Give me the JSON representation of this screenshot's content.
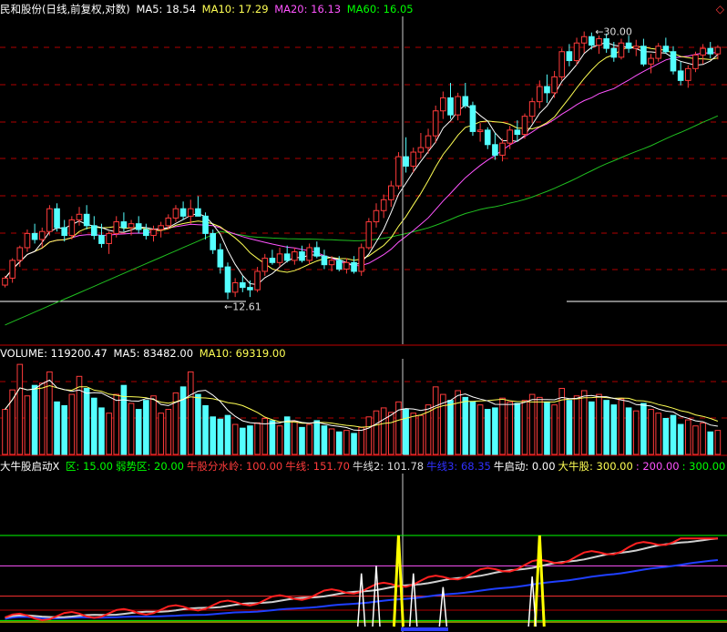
{
  "colors": {
    "up": "#ff3b3b",
    "down": "#54ffff",
    "ma5": "#ffffff",
    "ma10": "#ffff54",
    "ma20": "#ff54ff",
    "ma60": "#00c000",
    "grid": "#b00000",
    "bg": "#000000"
  },
  "panel_price": {
    "stock": "民和股份(日线,前复权,对数)",
    "ma5_label": "MA5: 18.54",
    "ma10_label": "MA10: 17.29",
    "ma20_label": "MA20: 16.13",
    "ma60_label": "MA60: 16.05",
    "high_marker": "30.00",
    "low_marker": "12.61",
    "corner_icon": "diamond-icon"
  },
  "panel_volume": {
    "volume_label": "VOLUME: 119200.47",
    "ma5_label": "MA5: 83482.00",
    "ma10_label": "MA10: 69319.00"
  },
  "panel_indicator": {
    "name": "大牛股启动X",
    "items": [
      {
        "text": "区: 15.00",
        "color": "#00ff00"
      },
      {
        "text": "弱势区: 20.00",
        "color": "#00ff00"
      },
      {
        "text": "牛股分水岭: 100.00",
        "color": "#ff3b3b"
      },
      {
        "text": "牛线: 151.70",
        "color": "#ff3b3b"
      },
      {
        "text": "牛线2: 101.78",
        "color": "#dddddd"
      },
      {
        "text": "牛线3: 68.35",
        "color": "#3030ff"
      },
      {
        "text": "牛启动: 0.00",
        "color": "#ffffff"
      },
      {
        "text": "大牛股: 300.00",
        "color": "#ffff54"
      },
      {
        "text": ": 200.00",
        "color": "#ff54ff"
      },
      {
        "text": ": 300.00",
        "color": "#00ff00"
      },
      {
        "text": ":",
        "color": "#ffffff"
      }
    ]
  },
  "chart_data": {
    "type": "candlestick",
    "log_scale": true,
    "ylim": [
      10.9,
      31.5
    ],
    "candles": [
      [
        13.2,
        13.6,
        13.1,
        13.5
      ],
      [
        13.5,
        14.4,
        13.3,
        14.3
      ],
      [
        14.3,
        15.0,
        14.0,
        14.9
      ],
      [
        14.9,
        15.8,
        14.7,
        15.6
      ],
      [
        15.6,
        16.1,
        15.1,
        15.3
      ],
      [
        15.3,
        15.9,
        14.9,
        15.7
      ],
      [
        15.7,
        17.1,
        15.5,
        16.9
      ],
      [
        16.9,
        17.2,
        15.7,
        15.9
      ],
      [
        15.9,
        16.3,
        15.2,
        15.5
      ],
      [
        15.5,
        16.5,
        15.3,
        16.3
      ],
      [
        16.3,
        17.0,
        16.0,
        16.6
      ],
      [
        16.6,
        17.1,
        15.8,
        16.0
      ],
      [
        16.0,
        16.5,
        15.3,
        15.5
      ],
      [
        15.5,
        16.1,
        14.9,
        15.1
      ],
      [
        15.1,
        15.7,
        14.6,
        15.6
      ],
      [
        15.6,
        16.5,
        15.4,
        16.2
      ],
      [
        16.2,
        16.7,
        15.7,
        15.9
      ],
      [
        15.9,
        16.3,
        15.5,
        16.1
      ],
      [
        16.1,
        16.5,
        15.6,
        15.8
      ],
      [
        15.8,
        16.1,
        15.3,
        15.5
      ],
      [
        15.5,
        16.0,
        15.2,
        15.8
      ],
      [
        15.8,
        16.2,
        15.4,
        16.0
      ],
      [
        16.0,
        16.6,
        15.8,
        16.4
      ],
      [
        16.4,
        17.1,
        16.2,
        16.9
      ],
      [
        16.9,
        17.3,
        16.3,
        16.5
      ],
      [
        16.5,
        17.4,
        16.1,
        16.9
      ],
      [
        16.9,
        17.6,
        16.6,
        16.5
      ],
      [
        16.5,
        16.7,
        15.3,
        15.6
      ],
      [
        15.6,
        15.8,
        14.6,
        14.8
      ],
      [
        14.8,
        15.1,
        13.7,
        14.0
      ],
      [
        14.0,
        14.2,
        12.61,
        12.9
      ],
      [
        12.9,
        13.5,
        12.7,
        13.3
      ],
      [
        13.3,
        13.6,
        12.9,
        13.1
      ],
      [
        13.1,
        13.4,
        12.7,
        13.0
      ],
      [
        13.0,
        14.0,
        12.9,
        13.8
      ],
      [
        13.8,
        14.6,
        13.6,
        14.4
      ],
      [
        14.4,
        14.8,
        14.1,
        14.2
      ],
      [
        14.2,
        14.9,
        14.0,
        14.6
      ],
      [
        14.6,
        15.0,
        14.2,
        14.3
      ],
      [
        14.3,
        14.9,
        14.1,
        14.7
      ],
      [
        14.7,
        15.0,
        14.2,
        14.3
      ],
      [
        14.3,
        15.1,
        14.1,
        14.9
      ],
      [
        14.9,
        15.2,
        14.4,
        14.5
      ],
      [
        14.5,
        14.8,
        13.9,
        14.1
      ],
      [
        14.1,
        14.5,
        13.8,
        14.3
      ],
      [
        14.3,
        14.5,
        13.8,
        13.9
      ],
      [
        13.9,
        14.4,
        13.7,
        14.2
      ],
      [
        14.2,
        14.5,
        13.7,
        13.8
      ],
      [
        13.8,
        15.1,
        13.6,
        14.9
      ],
      [
        14.9,
        16.4,
        14.8,
        16.2
      ],
      [
        16.2,
        17.2,
        15.9,
        16.8
      ],
      [
        16.8,
        17.7,
        16.4,
        17.4
      ],
      [
        17.4,
        18.5,
        17.0,
        18.2
      ],
      [
        18.2,
        20.3,
        18.0,
        20.0
      ],
      [
        20.0,
        21.3,
        19.0,
        19.4
      ],
      [
        19.4,
        20.6,
        19.0,
        20.3
      ],
      [
        20.3,
        21.6,
        19.9,
        20.6
      ],
      [
        20.6,
        21.9,
        20.2,
        21.4
      ],
      [
        21.4,
        23.6,
        20.9,
        23.2
      ],
      [
        23.2,
        24.7,
        22.6,
        24.2
      ],
      [
        24.2,
        25.4,
        22.6,
        22.9
      ],
      [
        22.9,
        24.6,
        22.5,
        24.3
      ],
      [
        24.3,
        25.4,
        23.4,
        23.6
      ],
      [
        23.6,
        23.9,
        21.4,
        21.7
      ],
      [
        21.7,
        22.3,
        21.0,
        21.8
      ],
      [
        21.8,
        22.0,
        20.5,
        20.8
      ],
      [
        20.8,
        21.6,
        19.8,
        20.1
      ],
      [
        20.1,
        21.2,
        19.7,
        20.9
      ],
      [
        20.9,
        22.1,
        20.5,
        21.8
      ],
      [
        21.8,
        22.5,
        21.0,
        21.5
      ],
      [
        21.5,
        23.0,
        21.2,
        22.8
      ],
      [
        22.8,
        24.2,
        22.3,
        23.9
      ],
      [
        23.9,
        25.6,
        23.4,
        25.1
      ],
      [
        25.1,
        26.1,
        23.8,
        24.6
      ],
      [
        24.6,
        26.4,
        24.2,
        25.9
      ],
      [
        25.9,
        28.4,
        25.6,
        28.1
      ],
      [
        28.1,
        28.8,
        26.8,
        27.3
      ],
      [
        27.3,
        29.4,
        26.9,
        28.9
      ],
      [
        28.9,
        30.0,
        28.0,
        29.5
      ],
      [
        29.5,
        29.9,
        28.3,
        28.7
      ],
      [
        28.7,
        29.6,
        27.9,
        29.3
      ],
      [
        29.3,
        29.8,
        28.0,
        28.4
      ],
      [
        28.4,
        29.0,
        27.2,
        27.6
      ],
      [
        27.6,
        29.3,
        27.4,
        28.9
      ],
      [
        28.9,
        29.6,
        28.0,
        28.4
      ],
      [
        28.4,
        29.2,
        27.7,
        28.6
      ],
      [
        28.6,
        29.3,
        26.8,
        27.0
      ],
      [
        27.0,
        27.9,
        26.2,
        27.5
      ],
      [
        27.5,
        28.9,
        27.2,
        28.6
      ],
      [
        28.6,
        29.4,
        27.9,
        28.1
      ],
      [
        28.1,
        28.6,
        26.1,
        26.4
      ],
      [
        26.4,
        27.2,
        25.2,
        25.6
      ],
      [
        25.6,
        26.9,
        25.0,
        26.6
      ],
      [
        26.6,
        28.1,
        26.3,
        27.8
      ],
      [
        27.8,
        28.8,
        27.0,
        28.4
      ],
      [
        28.4,
        29.0,
        27.5,
        27.9
      ],
      [
        27.9,
        28.7,
        27.4,
        28.5
      ]
    ],
    "volume": [
      60,
      86,
      120,
      78,
      92,
      95,
      110,
      70,
      65,
      80,
      104,
      88,
      75,
      62,
      55,
      80,
      92,
      68,
      60,
      72,
      78,
      55,
      60,
      82,
      90,
      110,
      80,
      65,
      50,
      47,
      52,
      40,
      35,
      38,
      42,
      48,
      45,
      38,
      50,
      44,
      36,
      40,
      45,
      38,
      34,
      30,
      32,
      28,
      36,
      50,
      58,
      62,
      56,
      70,
      60,
      55,
      52,
      66,
      90,
      80,
      72,
      85,
      76,
      70,
      66,
      60,
      62,
      75,
      70,
      68,
      72,
      80,
      76,
      70,
      66,
      88,
      72,
      78,
      85,
      70,
      80,
      72,
      66,
      74,
      62,
      58,
      68,
      60,
      55,
      48,
      52,
      40,
      46,
      38,
      42,
      30,
      32
    ],
    "indicator_ylim": [
      0,
      300
    ],
    "indicator_hlines": [
      15,
      20,
      100,
      200,
      300
    ],
    "start_spikes": [
      53,
      72
    ]
  }
}
